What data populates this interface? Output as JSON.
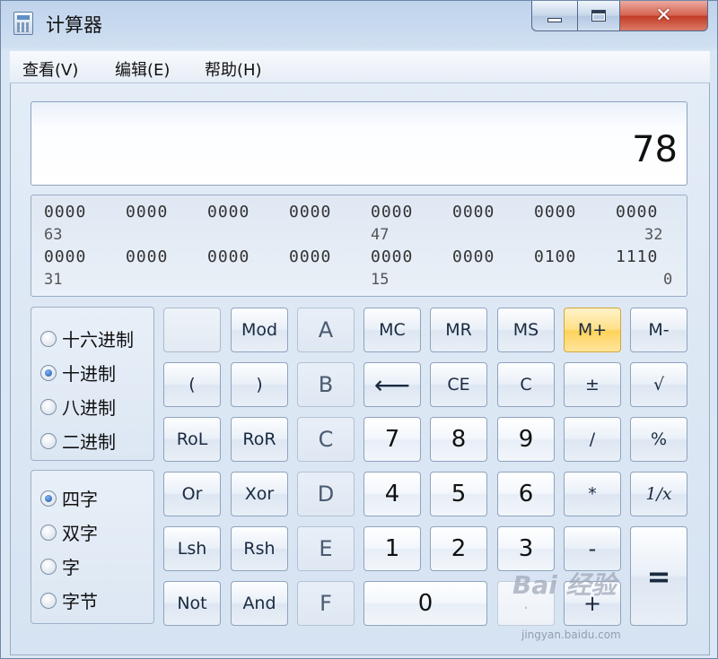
{
  "window": {
    "title": "计算器",
    "icon": "calculator-icon",
    "controls": {
      "minimize": "minimize-icon",
      "maximize": "maximize-icon",
      "close": "✕"
    }
  },
  "menu": [
    "查看(V)",
    "编辑(E)",
    "帮助(H)"
  ],
  "display": {
    "value": "78"
  },
  "bits": {
    "row1": [
      "0000",
      "0000",
      "0000",
      "0000",
      "0000",
      "0000",
      "0000",
      "0000"
    ],
    "row1_positions": [
      "63",
      "47",
      "32"
    ],
    "row2": [
      "0000",
      "0000",
      "0000",
      "0000",
      "0000",
      "0000",
      "0100",
      "1110"
    ],
    "row2_positions": [
      "31",
      "15",
      "0"
    ]
  },
  "base_options": [
    {
      "label": "十六进制",
      "checked": false
    },
    {
      "label": "十进制",
      "checked": true
    },
    {
      "label": "八进制",
      "checked": false
    },
    {
      "label": "二进制",
      "checked": false
    }
  ],
  "word_options": [
    {
      "label": "四字",
      "checked": true
    },
    {
      "label": "双字",
      "checked": false
    },
    {
      "label": "字",
      "checked": false
    },
    {
      "label": "字节",
      "checked": false
    }
  ],
  "keys": {
    "blank": "",
    "mod": "Mod",
    "a": "A",
    "mc": "MC",
    "mr": "MR",
    "ms": "MS",
    "mplus": "M+",
    "mminus": "M-",
    "lparen": "(",
    "rparen": ")",
    "b": "B",
    "backspace": "⟵",
    "ce": "CE",
    "c": "C",
    "plusminus": "±",
    "sqrt": "√",
    "rol": "RoL",
    "ror": "RoR",
    "hexc": "C",
    "seven": "7",
    "eight": "8",
    "nine": "9",
    "divide": "/",
    "percent": "%",
    "or": "Or",
    "xor": "Xor",
    "d": "D",
    "four": "4",
    "five": "5",
    "six": "6",
    "multiply": "*",
    "reciprocal": "1/x",
    "lsh": "Lsh",
    "rsh": "Rsh",
    "e": "E",
    "one": "1",
    "two": "2",
    "three": "3",
    "minus": "-",
    "equals": "=",
    "not": "Not",
    "and": "And",
    "f": "F",
    "zero": "0",
    "dot": ".",
    "plus": "+"
  },
  "watermark": {
    "brand": "Bai 经验",
    "url": "jingyan.baidu.com"
  }
}
